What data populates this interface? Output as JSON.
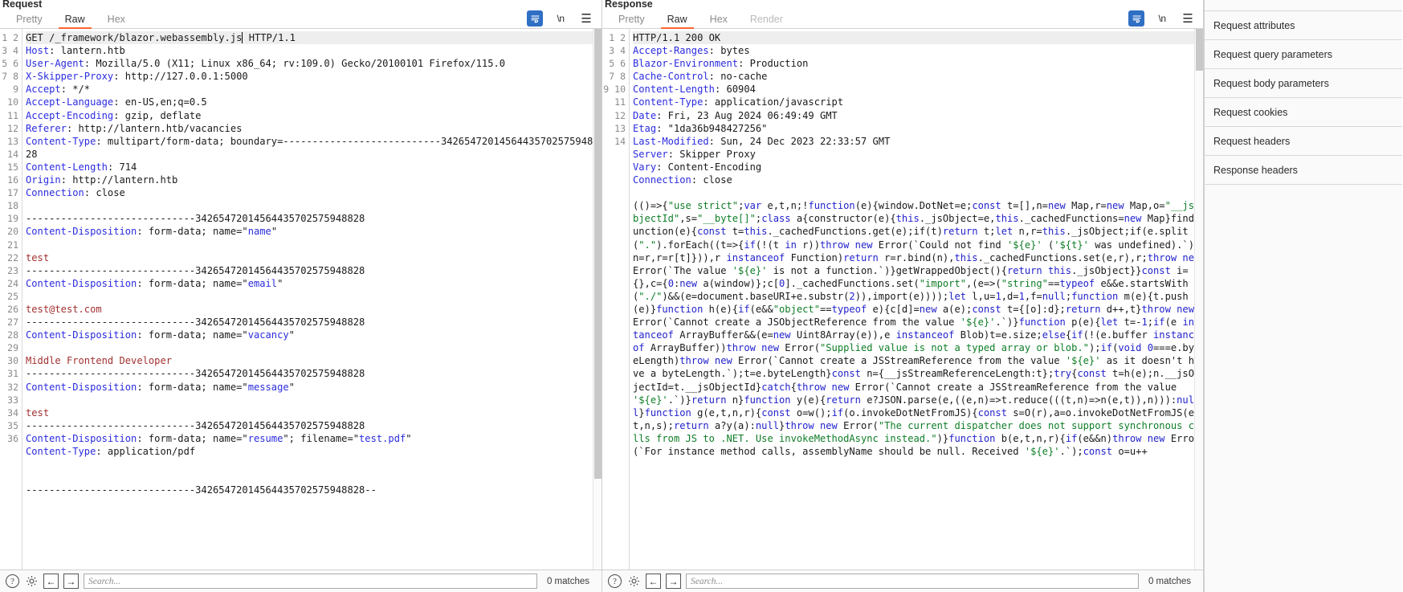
{
  "request": {
    "title": "Request",
    "tabs": [
      {
        "label": "Pretty",
        "active": false,
        "disabled": false
      },
      {
        "label": "Raw",
        "active": true,
        "disabled": false
      },
      {
        "label": "Hex",
        "active": false,
        "disabled": false
      }
    ],
    "actions": {
      "wrap_icon": "word-wrap-icon",
      "newline_label": "\\n",
      "menu_icon": "hamburger-menu-icon"
    },
    "lines": [
      "GET /_framework/blazor.webassembly.js HTTP/1.1",
      "Host: lantern.htb",
      "User-Agent: Mozilla/5.0 (X11; Linux x86_64; rv:109.0) Gecko/20100101 Firefox/115.0",
      "X-Skipper-Proxy: http://127.0.0.1:5000",
      "Accept: */*",
      "Accept-Language: en-US,en;q=0.5",
      "Accept-Encoding: gzip, deflate",
      "Referer: http://lantern.htb/vacancies",
      "Content-Type: multipart/form-data; boundary=---------------------------34265472014564435702575948828",
      "Content-Length: 714",
      "Origin: http://lantern.htb",
      "Connection: close",
      "",
      "-----------------------------34265472014564435702575948828",
      "Content-Disposition: form-data; name=\"name\"",
      "",
      "test",
      "-----------------------------34265472014564435702575948828",
      "Content-Disposition: form-data; name=\"email\"",
      "",
      "test@test.com",
      "-----------------------------34265472014564435702575948828",
      "Content-Disposition: form-data; name=\"vacancy\"",
      "",
      "Middle Frontend Developer",
      "-----------------------------34265472014564435702575948828",
      "Content-Disposition: form-data; name=\"message\"",
      "",
      "test",
      "-----------------------------34265472014564435702575948828",
      "Content-Disposition: form-data; name=\"resume\"; filename=\"test.pdf\"",
      "Content-Type: application/pdf",
      "",
      "",
      "-----------------------------34265472014564435702575948828--",
      ""
    ],
    "search": {
      "placeholder": "Search...",
      "value": "",
      "matches": "0 matches"
    }
  },
  "response": {
    "title": "Response",
    "tabs": [
      {
        "label": "Pretty",
        "active": false,
        "disabled": false
      },
      {
        "label": "Raw",
        "active": true,
        "disabled": false
      },
      {
        "label": "Hex",
        "active": false,
        "disabled": false
      },
      {
        "label": "Render",
        "active": false,
        "disabled": true
      }
    ],
    "actions": {
      "wrap_icon": "word-wrap-icon",
      "newline_label": "\\n",
      "menu_icon": "hamburger-menu-icon"
    },
    "headers": [
      "HTTP/1.1 200 OK",
      "Accept-Ranges: bytes",
      "Blazor-Environment: Production",
      "Cache-Control: no-cache",
      "Content-Length: 60904",
      "Content-Type: application/javascript",
      "Date: Fri, 23 Aug 2024 06:49:49 GMT",
      "Etag: \"1da36b948427256\"",
      "Last-Modified: Sun, 24 Dec 2023 22:33:57 GMT",
      "Server: Skipper Proxy",
      "Vary: Content-Encoding",
      "Connection: close",
      ""
    ],
    "body": "(()=>{\"use strict\";var e,t,n;!function(e){window.DotNet=e;const t=[],n=new Map,r=new Map,o=\"__jsObjectId\",s=\"__byte[]\";class a{constructor(e){this._jsObject=e,this._cachedFunctions=new Map}findFunction(e){const t=this._cachedFunctions.get(e);if(t)return t;let n,r=this._jsObject;if(e.split(\".\").forEach((t=>{if(!(t in r))throw new Error(`Could not find '${e}' ('${t}' was undefined).`);n=r,r=r[t]})),r instanceof Function)return r=r.bind(n),this._cachedFunctions.set(e,r),r;throw new Error(`The value '${e}' is not a function.`)}getWrappedObject(){return this._jsObject}}const i={},c={0:new a(window)};c[0]._cachedFunctions.set(\"import\",(e=>(\"string\"==typeof e&&e.startsWith(\"./\")&&(e=document.baseURI+e.substr(2)),import(e))));let l,u=1,d=1,f=null;function m(e){t.push(e)}function h(e){if(e&&\"object\"==typeof e){c[d]=new a(e);const t={[o]:d};return d++,t}throw new Error(`Cannot create a JSObjectReference from the value '${e}'.`)}function p(e){let t=-1;if(e instanceof ArrayBuffer&&(e=new Uint8Array(e)),e instanceof Blob)t=e.size;else{if(!(e.buffer instanceof ArrayBuffer))throw new Error(\"Supplied value is not a typed array or blob.\");if(void 0===e.byteLength)throw new Error(`Cannot create a JSStreamReference from the value '${e}' as it doesn't have a byteLength.`);t=e.byteLength}const n={__jsStreamReferenceLength:t};try{const t=h(e);n.__jsObjectId=t.__jsObjectId}catch{throw new Error(`Cannot create a JSStreamReference from the value '${e}'.`)}return n}function y(e){return e?JSON.parse(e,((e,n)=>t.reduce(((t,n)=>n(e,t)),n))):null}function g(e,t,n,r){const o=w();if(o.invokeDotNetFromJS){const s=O(r),a=o.invokeDotNetFromJS(e,t,n,s);return a?y(a):null}throw new Error(\"The current dispatcher does not support synchronous calls from JS to .NET. Use invokeMethodAsync instead.\")}function b(e,t,n,r){if(e&&n)throw new Error(`For instance method calls, assemblyName should be null. Received '${e}'.`);const o=u++"
  },
  "bottom": {
    "help_icon": "help-circle-icon",
    "settings_icon": "gear-icon",
    "prev_icon": "arrow-left-icon",
    "next_icon": "arrow-right-icon"
  },
  "sidebar": {
    "items": [
      {
        "label": "Request attributes"
      },
      {
        "label": "Request query parameters"
      },
      {
        "label": "Request body parameters"
      },
      {
        "label": "Request cookies"
      },
      {
        "label": "Request headers"
      },
      {
        "label": "Response headers"
      }
    ]
  },
  "colors": {
    "accent": "#ff6633",
    "selected_icon_bg": "#2f6fc4",
    "header_name": "#2b2be0",
    "body_text": "#a33030",
    "js_keyword": "#2222cc",
    "js_string": "#0f7d27"
  }
}
